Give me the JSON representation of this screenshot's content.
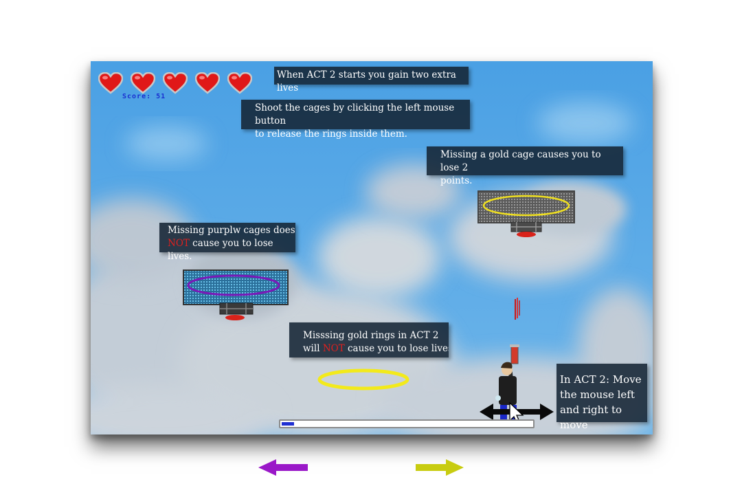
{
  "hud": {
    "lives": 5,
    "score_label": "Score: 51"
  },
  "tips": {
    "act2_lives": "When ACT 2 starts you gain two extra lives",
    "shoot_cages_line1": "Shoot the cages  by clicking the left mouse button",
    "shoot_cages_line2": "to release the rings inside them.",
    "gold_cage_line1": "Missing a gold cage causes you to lose 2",
    "gold_cage_line2": "points.",
    "purple_cage_line1": "Missing purplw cages does",
    "purple_cage_not": "NOT",
    "purple_cage_rest": " cause you to lose lives.",
    "gold_rings_line1": "Misssing gold rings in ACT 2",
    "gold_rings_will": "will ",
    "gold_rings_not": "NOT",
    "gold_rings_rest": " cause you to lose lives",
    "move_line1": "In ACT 2: Move",
    "move_line2": "the mouse left",
    "move_line3": "and right to move"
  },
  "progress": {
    "value": 0.05
  },
  "colors": {
    "sky": "#5aa9e6",
    "tip_bg": "#142434",
    "warning_red": "#e0201e",
    "score_blue": "#1a2fd0",
    "gold": "#f0e020",
    "purple": "#7a18b8",
    "left_arrow": "#9a18c8",
    "right_arrow": "#c8cc10"
  },
  "icons": {
    "life": "heart-icon",
    "cursor": "mouse-pointer-icon",
    "move_hint": "double-arrow-icon"
  }
}
